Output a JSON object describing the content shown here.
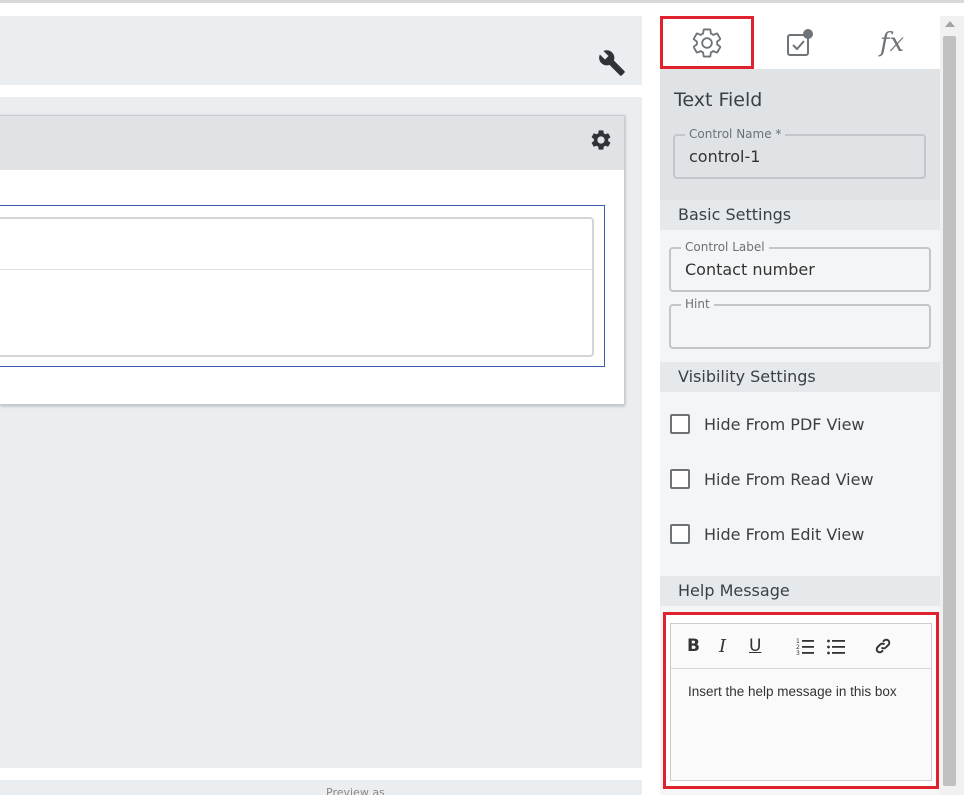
{
  "canvas": {
    "preview_text": "Preview as"
  },
  "panel": {
    "tabs": [
      {
        "name": "settings",
        "icon": "gear-icon"
      },
      {
        "name": "rules",
        "icon": "checkbox-badge-icon"
      },
      {
        "name": "formula",
        "label": "fx"
      }
    ],
    "title": "Text Field",
    "control_name": {
      "label": "Control Name *",
      "value": "control-1"
    },
    "basic_settings": {
      "heading": "Basic Settings",
      "control_label": {
        "label": "Control Label",
        "value": "Contact number"
      },
      "hint": {
        "label": "Hint",
        "value": ""
      }
    },
    "visibility_settings": {
      "heading": "Visibility Settings",
      "options": [
        {
          "label": "Hide From PDF View",
          "checked": false
        },
        {
          "label": "Hide From Read View",
          "checked": false
        },
        {
          "label": "Hide From Edit View",
          "checked": false
        }
      ]
    },
    "help_message": {
      "heading": "Help Message",
      "toolbar": {
        "bold": "B",
        "italic": "I",
        "underline": "U"
      },
      "text": "Insert the help message in this box"
    }
  },
  "colors": {
    "highlight": "#e0212e",
    "selection": "#3c5bb3",
    "canvas_bg": "#eaeef1"
  }
}
